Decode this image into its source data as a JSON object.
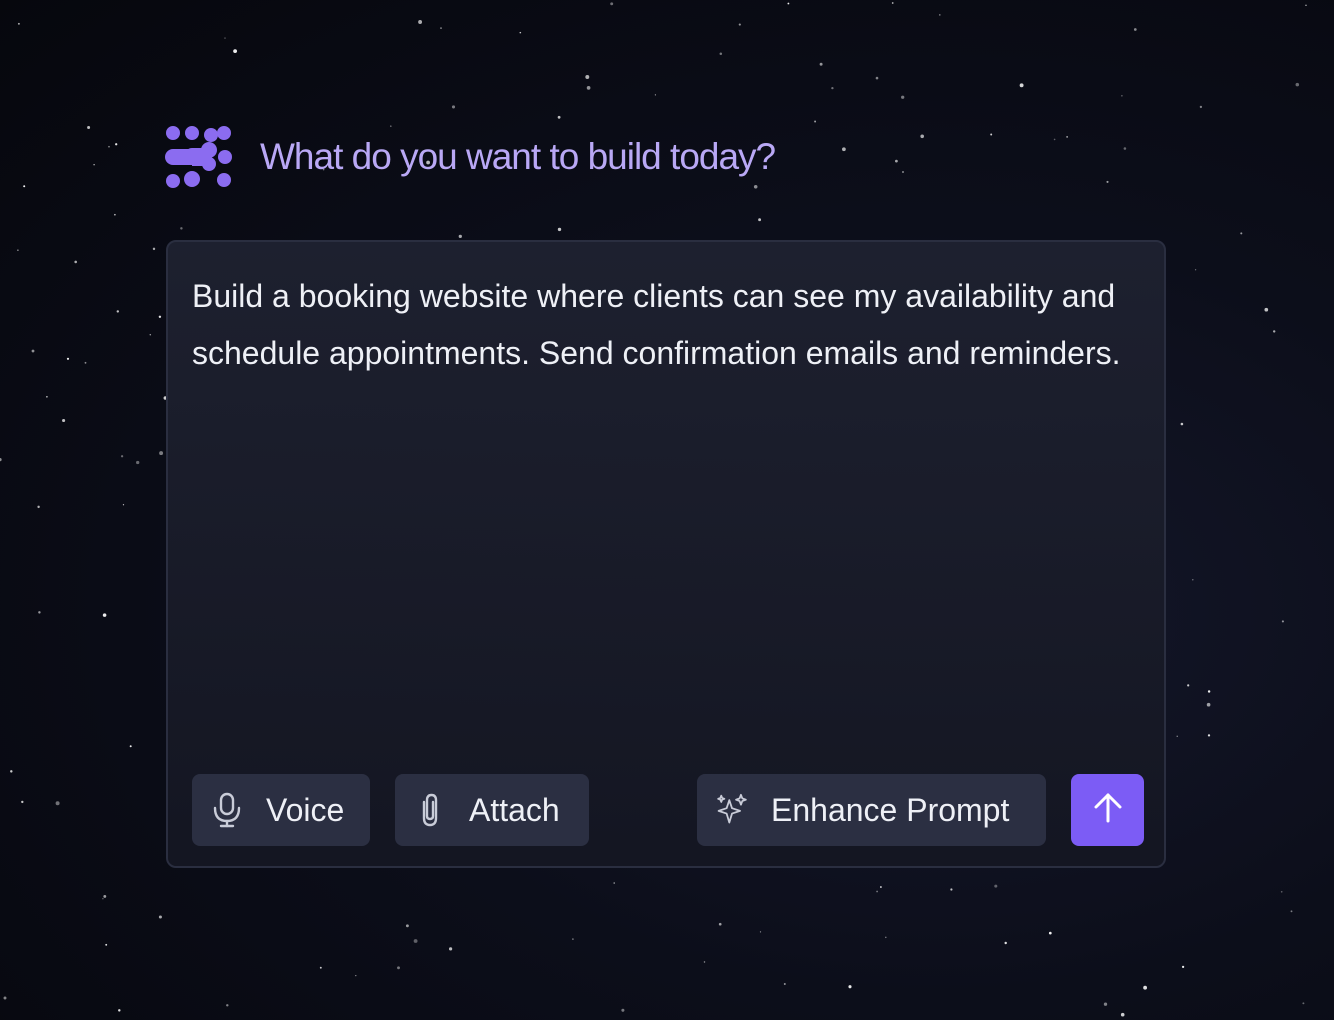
{
  "header": {
    "title": "What do you want to build today?",
    "logo_icon": "purple-dots-logo"
  },
  "prompt": {
    "text": "Build a booking website where clients can see my availability and schedule appointments. Send confirmation emails and reminders."
  },
  "toolbar": {
    "voice_label": "Voice",
    "voice_icon": "microphone-icon",
    "attach_label": "Attach",
    "attach_icon": "paperclip-icon",
    "enhance_label": "Enhance Prompt",
    "enhance_icon": "sparkles-icon",
    "send_icon": "arrow-up-icon"
  },
  "colors": {
    "accent": "#7c5cf5",
    "title": "#b9a8f5",
    "background": "#0c0e1a",
    "card": "#1c1f2e",
    "button": "#2b2f42"
  }
}
